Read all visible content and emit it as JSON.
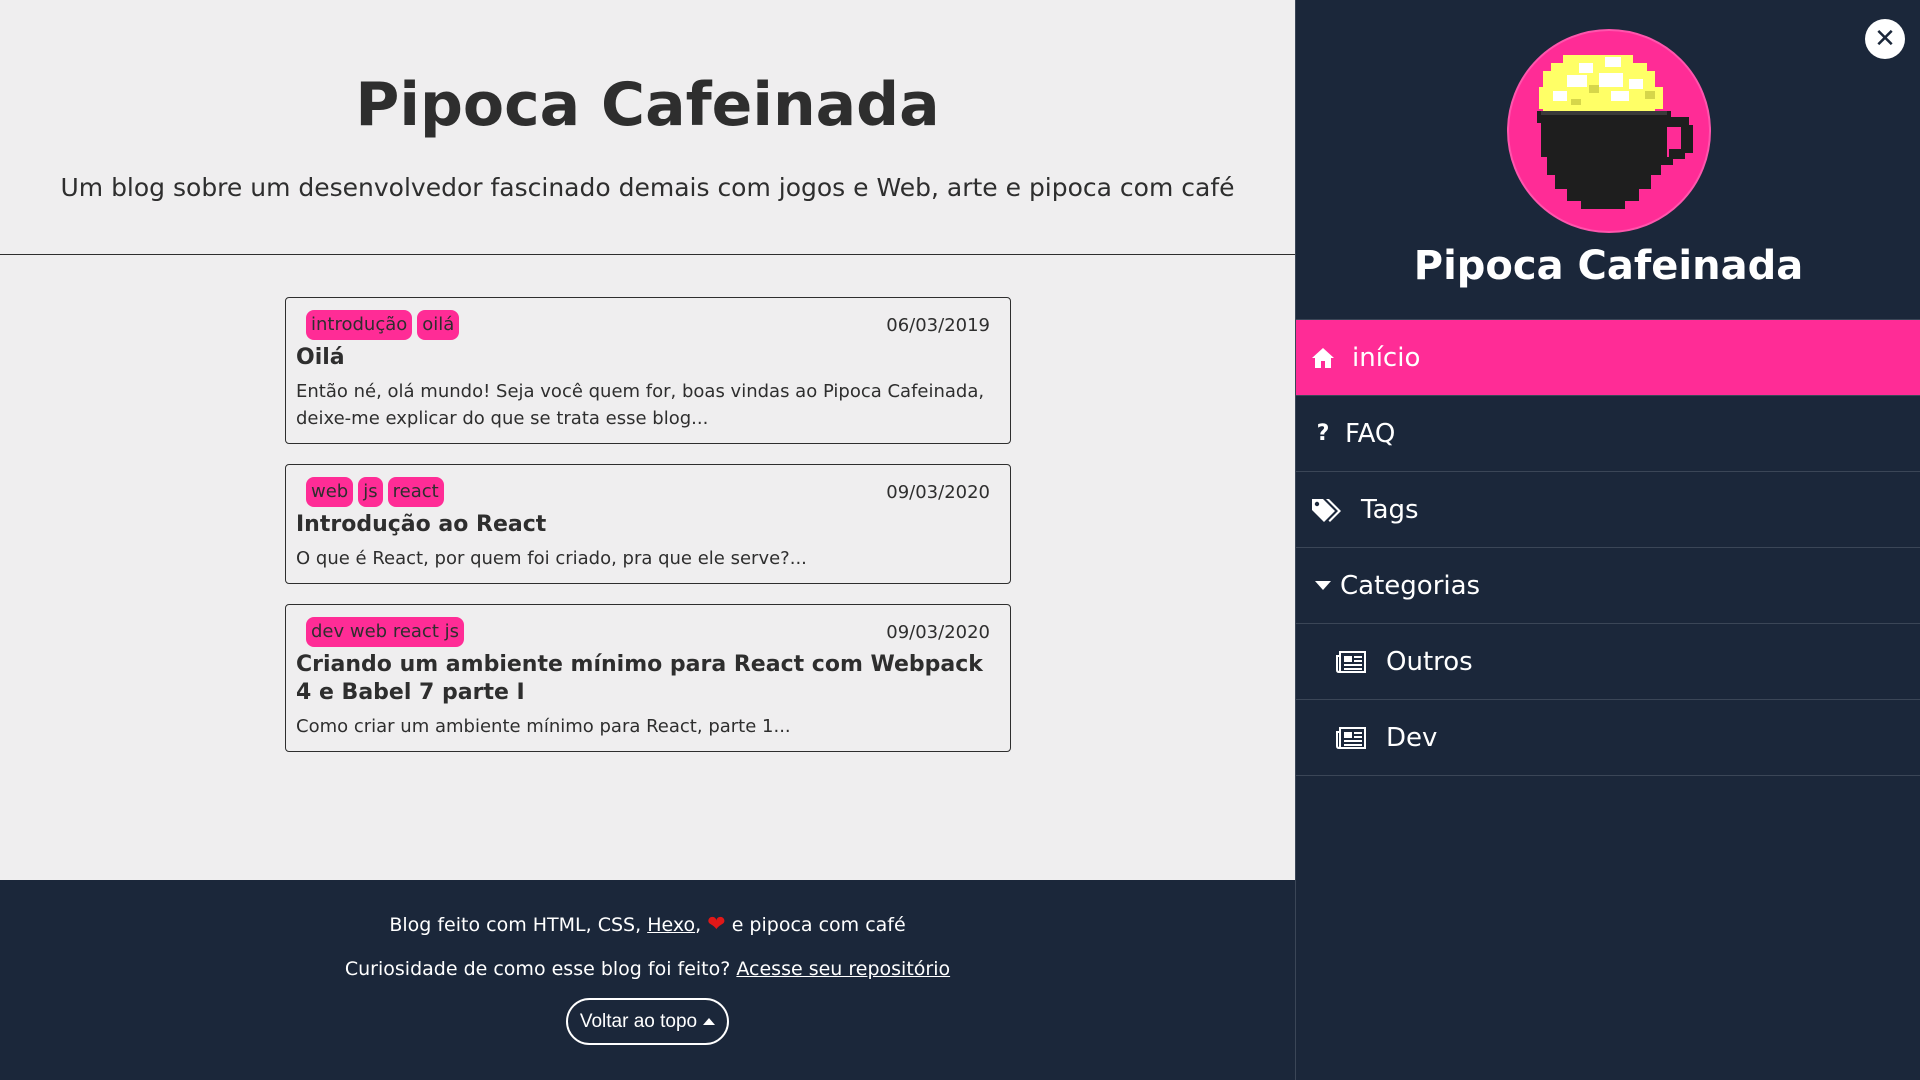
{
  "site": {
    "title": "Pipoca Cafeinada",
    "description": "Um blog sobre um desenvolvedor fascinado demais com jogos e Web, arte e pipoca com café"
  },
  "posts": [
    {
      "tags": [
        "introdução",
        "oilá"
      ],
      "date": "06/03/2019",
      "title": "Oilá",
      "excerpt": "Então né, olá mundo! Seja você quem for, boas vindas ao Pipoca Cafeinada, deixe-me explicar do que se trata esse blog..."
    },
    {
      "tags": [
        "web",
        "js",
        "react"
      ],
      "date": "09/03/2020",
      "title": "Introdução ao React",
      "excerpt": "O que é React, por quem foi criado, pra que ele serve?..."
    },
    {
      "tags": [
        "dev web react js"
      ],
      "date": "09/03/2020",
      "title": "Criando um ambiente mínimo para React com Webpack 4 e Babel 7 parte I",
      "excerpt": "Como criar um ambiente mínimo para React, parte 1..."
    }
  ],
  "footer": {
    "line1_pre": "Blog feito com HTML, CSS, ",
    "line1_link": "Hexo",
    "line1_comma": ",",
    "line1_post": " e pipoca com café",
    "line2_pre": "Curiosidade de como esse blog foi feito? ",
    "line2_link": "Acesse seu repositório",
    "back_to_top": "Voltar ao topo"
  },
  "sidebar": {
    "title": "Pipoca Cafeinada",
    "close_icon": "close-icon",
    "menu": [
      {
        "label": "início",
        "icon": "home-icon",
        "active": true
      },
      {
        "label": "FAQ",
        "icon": "question-icon"
      },
      {
        "label": "Tags",
        "icon": "tags-icon"
      },
      {
        "label": "Categorias",
        "icon": "caret-down-icon"
      },
      {
        "label": "Outros",
        "icon": "newspaper-icon"
      },
      {
        "label": "Dev",
        "icon": "newspaper-icon"
      }
    ]
  },
  "colors": {
    "accent": "#ff2c96",
    "dark": "#1b273a",
    "background": "#efeeef",
    "text": "#2e2e2e"
  }
}
